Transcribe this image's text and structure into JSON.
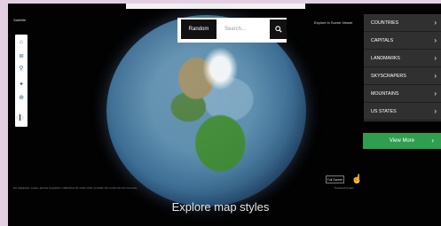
{
  "header": {
    "left_label": "Satellite",
    "right_label": "Explore in Scene Viewer"
  },
  "search": {
    "random_label": "Random",
    "placeholder": "Search...",
    "search_icon": "magnifier-icon"
  },
  "menu": {
    "items": [
      {
        "label": "COUNTRIES"
      },
      {
        "label": "CAPITALS"
      },
      {
        "label": "LANDMARKS"
      },
      {
        "label": "SKYSCRAPERS"
      },
      {
        "label": "MOUNTAINS"
      },
      {
        "label": "US STATES"
      }
    ],
    "view_more_label": "View More",
    "arrow": "›"
  },
  "controls": {
    "full_screen_label": "Full Screen",
    "powered_by": "Powered by Esri"
  },
  "footer": {
    "caption": "Explore map styles",
    "attribution": "Esri, DigitalGlobe, GeoEye, Earthstar Geographics, CNES/Airbus DS, USDA, USGS, AeroGRID, IGN, and the GIS User Community"
  }
}
